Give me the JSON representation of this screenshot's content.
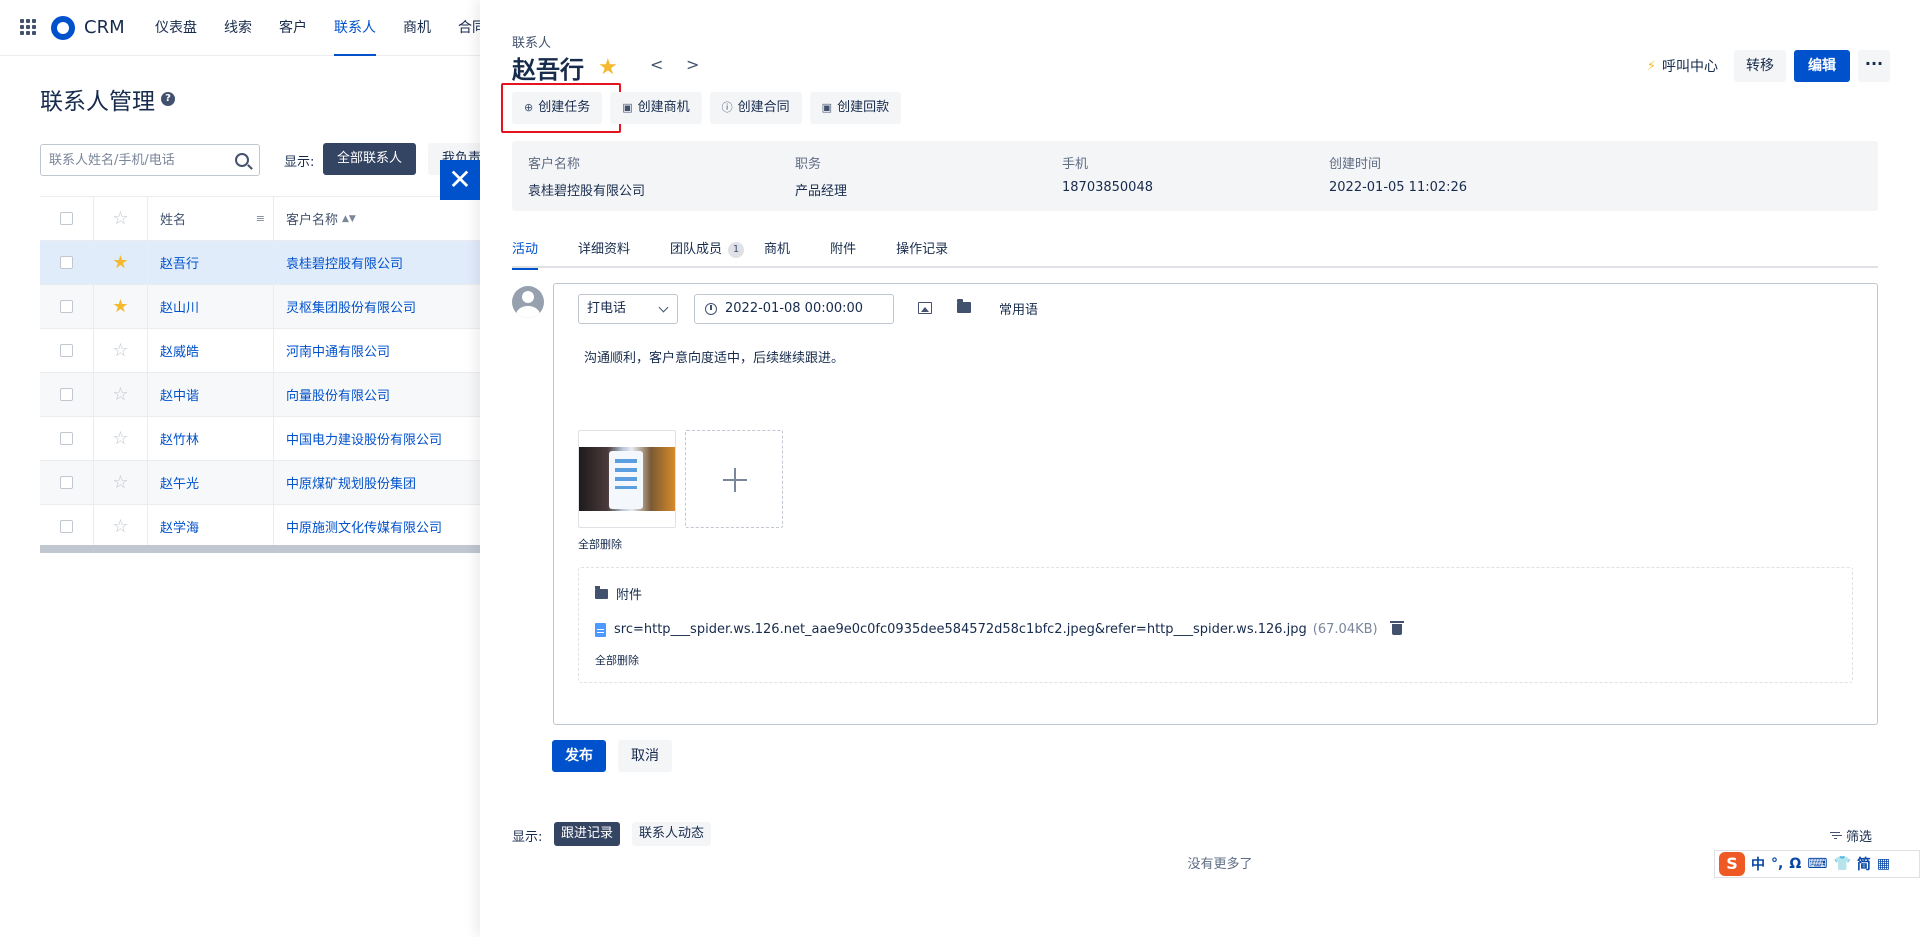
{
  "topnav": {
    "brand": "CRM",
    "items": [
      "仪表盘",
      "线索",
      "客户",
      "联系人",
      "商机",
      "合同"
    ],
    "active_index": 3
  },
  "list_page": {
    "title": "联系人管理",
    "search_placeholder": "联系人姓名/手机/电话",
    "show_label": "显示:",
    "filter_all": "全部联系人",
    "filter_mine": "我负责",
    "columns": {
      "name": "姓名",
      "customer": "客户名称"
    },
    "rows": [
      {
        "name": "赵吾行",
        "customer": "袁桂碧控股有限公司",
        "starred": true
      },
      {
        "name": "赵山川",
        "customer": "灵枢集团股份有限公司",
        "starred": true
      },
      {
        "name": "赵威皓",
        "customer": "河南中通有限公司",
        "starred": false
      },
      {
        "name": "赵中谐",
        "customer": "向量股份有限公司",
        "starred": false
      },
      {
        "name": "赵竹林",
        "customer": "中国电力建设股份有限公司",
        "starred": false
      },
      {
        "name": "赵午光",
        "customer": "中原煤矿规划股份集团",
        "starred": false
      },
      {
        "name": "赵学海",
        "customer": "中原施测文化传媒有限公司",
        "starred": false
      }
    ]
  },
  "drawer": {
    "breadcrumb": "联系人",
    "name": "赵吾行",
    "call_center": "呼叫中心",
    "transfer": "转移",
    "edit": "编辑",
    "more": "···",
    "actions": [
      "创建任务",
      "创建商机",
      "创建合同",
      "创建回款"
    ],
    "info": [
      {
        "label": "客户名称",
        "value": "袁桂碧控股有限公司"
      },
      {
        "label": "职务",
        "value": "产品经理"
      },
      {
        "label": "手机",
        "value": "18703850048"
      },
      {
        "label": "创建时间",
        "value": "2022-01-05 11:02:26"
      }
    ],
    "tabs": [
      "活动",
      "详细资料",
      "团队成员",
      "商机",
      "附件",
      "操作记录"
    ],
    "team_count": "1",
    "editor": {
      "type": "打电话",
      "datetime": "2022-01-08 00:00:00",
      "phrases": "常用语",
      "note": "沟通顺利，客户意向度适中，后续继续跟进。",
      "delete_all_images": "全部删除",
      "attachments_title": "附件",
      "file_name": "src=http___spider.ws.126.net_aae9e0c0fc0935dee584572d58c1bfc2.jpeg&refer=http___spider.ws.126.jpg",
      "file_size": "(67.04KB)",
      "delete_all_files": "全部删除"
    },
    "publish": "发布",
    "cancel": "取消",
    "show_label": "显示:",
    "pill_followup": "跟进记录",
    "pill_contact": "联系人动态",
    "filter": "筛选",
    "no_more": "没有更多了"
  },
  "ime": [
    "中",
    "°,",
    "Ω",
    "⌨",
    "👕",
    "简",
    "▦"
  ],
  "colors": {
    "primary": "#0052cc",
    "star": "#f5b82e",
    "highlight": "#e5131d",
    "dark_pill": "#344563"
  }
}
